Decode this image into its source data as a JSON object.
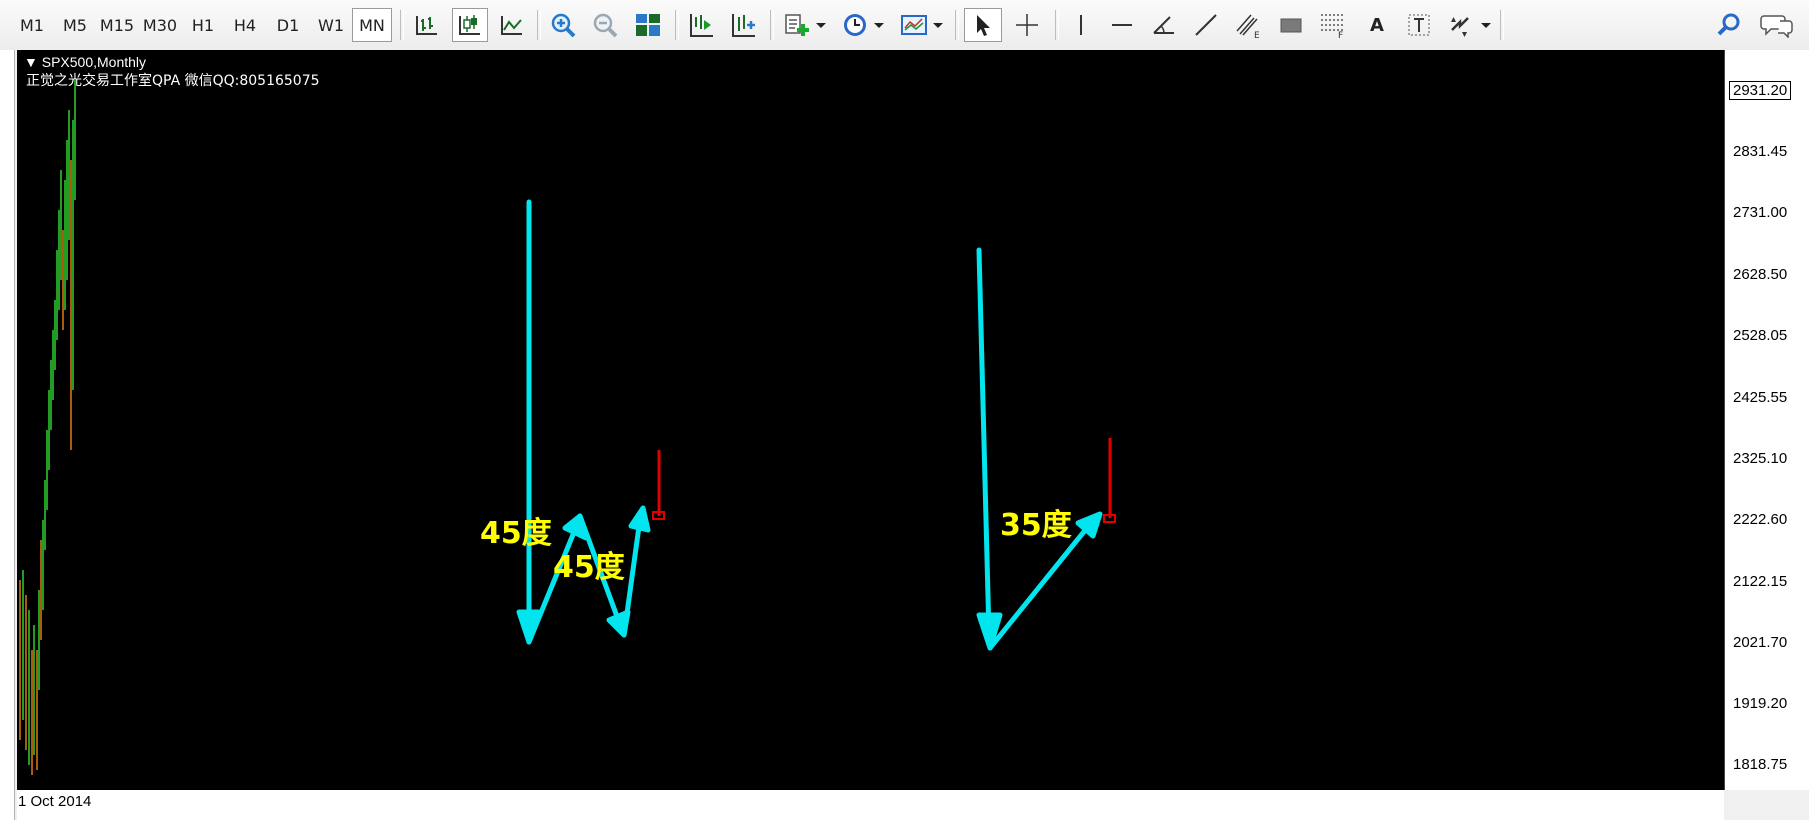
{
  "toolbar": {
    "timeframes": [
      "M1",
      "M5",
      "M15",
      "M30",
      "H1",
      "H4",
      "D1",
      "W1",
      "MN"
    ],
    "active_timeframe": "MN",
    "icons": [
      "bar-chart-icon",
      "candlestick-chart-icon",
      "line-chart-icon",
      "zoom-in-icon",
      "zoom-out-icon",
      "tile-windows-icon",
      "auto-scroll-icon",
      "chart-shift-icon",
      "indicators-icon",
      "periodicity-icon",
      "templates-icon",
      "cursor-icon",
      "crosshair-icon",
      "vertical-line-icon",
      "horizontal-line-icon",
      "angle-line-icon",
      "trendline-icon",
      "equidistant-channel-icon",
      "rectangle-icon",
      "fibonacci-icon",
      "text-icon",
      "text-label-icon",
      "arrows-icon",
      "search-icon",
      "chat-icon"
    ],
    "text_tool_label": "A"
  },
  "chart": {
    "symbol_label": "SPX500,Monthly",
    "watermark": "正觉之光交易工作室QPA 微信QQ:805165075",
    "current_price": "2931.20",
    "price_labels": [
      "2831.45",
      "2731.00",
      "2628.50",
      "2528.05",
      "2425.55",
      "2325.10",
      "2222.60",
      "2122.15",
      "2021.70",
      "1919.20",
      "1818.75"
    ],
    "time_label": "1 Oct 2014",
    "annotations": {
      "label_1": "45度",
      "label_2": "45度",
      "label_3": "35度"
    },
    "colors": {
      "background": "#000000",
      "arrow": "#00e5ee",
      "marker": "#e00000",
      "annotation_text": "#ffff00",
      "candle_up": "#2ed12e",
      "candle_down": "#e07a10"
    }
  }
}
